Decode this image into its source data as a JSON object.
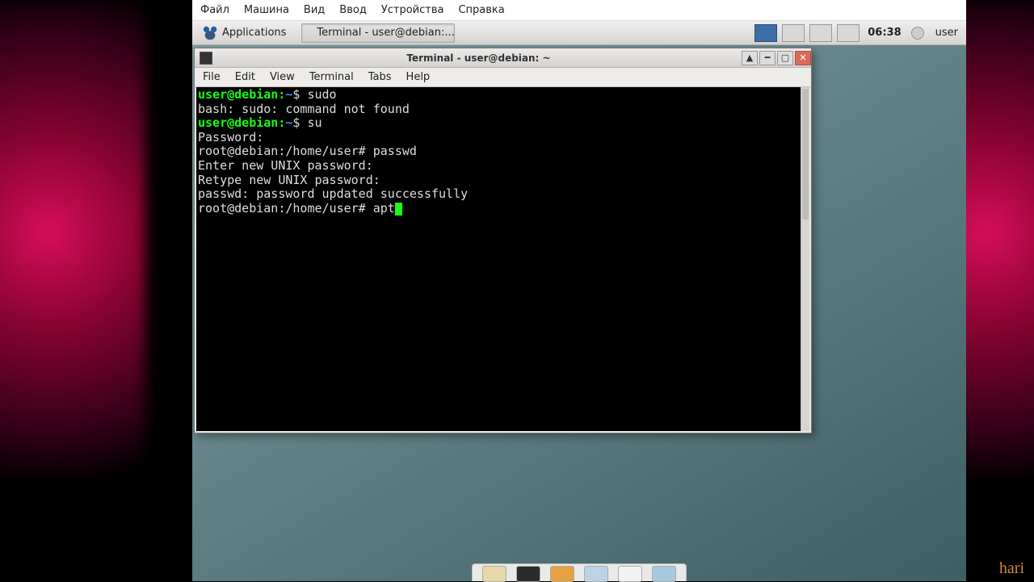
{
  "vb_menu": {
    "items": [
      "Файл",
      "Машина",
      "Вид",
      "Ввод",
      "Устройства",
      "Справка"
    ]
  },
  "xfce_panel": {
    "applications": "Applications",
    "task_label": "Terminal - user@debian:...",
    "clock": "06:38",
    "user": "user"
  },
  "terminal_window": {
    "title": "Terminal - user@debian: ~",
    "menu": [
      "File",
      "Edit",
      "View",
      "Terminal",
      "Tabs",
      "Help"
    ]
  },
  "terminal_lines": [
    {
      "type": "user_prompt",
      "user": "user",
      "host": "debian",
      "path": "~",
      "sym": "$",
      "cmd": "sudo"
    },
    {
      "type": "plain",
      "text": "bash: sudo: command not found"
    },
    {
      "type": "user_prompt",
      "user": "user",
      "host": "debian",
      "path": "~",
      "sym": "$",
      "cmd": "su"
    },
    {
      "type": "plain",
      "text": "Password:"
    },
    {
      "type": "root_prompt",
      "prefix": "root@debian:/home/user#",
      "cmd": "passwd"
    },
    {
      "type": "plain",
      "text": "Enter new UNIX password:"
    },
    {
      "type": "plain",
      "text": "Retype new UNIX password:"
    },
    {
      "type": "plain",
      "text": "passwd: password updated successfully"
    },
    {
      "type": "root_prompt_cursor",
      "prefix": "root@debian:/home/user#",
      "cmd": "apt"
    }
  ],
  "watermark": "hari",
  "colors": {
    "prompt_green": "#14ff14",
    "prompt_blue": "#3a8dff"
  },
  "dock_icons": [
    "file-manager",
    "terminal",
    "package-manager",
    "web-browser",
    "text-editor",
    "mail"
  ]
}
